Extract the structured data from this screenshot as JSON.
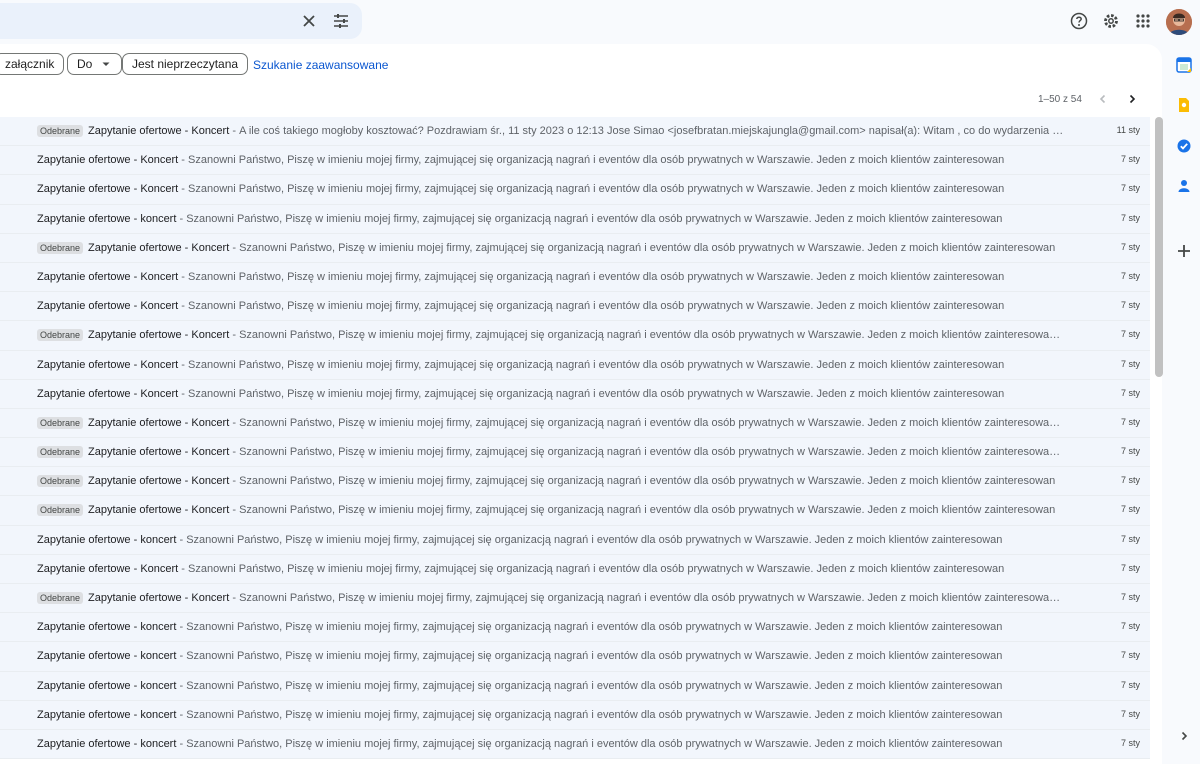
{
  "search": {
    "value": "",
    "placeholder": ""
  },
  "filters": [
    {
      "label": "załącznik"
    },
    {
      "label": "Do"
    },
    {
      "label": "Jest nieprzeczytana"
    }
  ],
  "advanced_search": "Szukanie zaawansowane",
  "pager": {
    "range": "1–50 z 54"
  },
  "emails": [
    {
      "badge": "Odebrane",
      "subject": "Zapytanie ofertowe - Koncert",
      "snippet": "A ile coś takiego mogłoby kosztować? Pozdrawiam śr., 11 sty 2023 o 12:13 Jose Simao <josefbratan.miejskajungla@gmail.com> napisał(a): Witam , co do wydarzenia jest to morzliwe ...",
      "date": "11 sty"
    },
    {
      "badge": "",
      "subject": "Zapytanie ofertowe - Koncert",
      "snippet": "Szanowni Państwo, Piszę w imieniu mojej firmy, zajmującej się organizacją nagrań i eventów dla osób prywatnych w Warszawie. Jeden z moich klientów zainteresowan",
      "date": "7 sty"
    },
    {
      "badge": "",
      "subject": "Zapytanie ofertowe - Koncert",
      "snippet": "Szanowni Państwo, Piszę w imieniu mojej firmy, zajmującej się organizacją nagrań i eventów dla osób prywatnych w Warszawie. Jeden z moich klientów zainteresowan",
      "date": "7 sty"
    },
    {
      "badge": "",
      "subject": "Zapytanie ofertowe - koncert",
      "snippet": "Szanowni Państwo, Piszę w imieniu mojej firmy, zajmującej się organizacją nagrań i eventów dla osób prywatnych w Warszawie. Jeden z moich klientów zainteresowan",
      "date": "7 sty"
    },
    {
      "badge": "Odebrane",
      "subject": "Zapytanie ofertowe - Koncert",
      "snippet": "Szanowni Państwo, Piszę w imieniu mojej firmy, zajmującej się organizacją nagrań i eventów dla osób prywatnych w Warszawie. Jeden z moich klientów zainteresowan",
      "date": "7 sty"
    },
    {
      "badge": "",
      "subject": "Zapytanie ofertowe - Koncert",
      "snippet": "Szanowni Państwo, Piszę w imieniu mojej firmy, zajmującej się organizacją nagrań i eventów dla osób prywatnych w Warszawie. Jeden z moich klientów zainteresowan",
      "date": "7 sty"
    },
    {
      "badge": "",
      "subject": "Zapytanie ofertowe - Koncert",
      "snippet": "Szanowni Państwo, Piszę w imieniu mojej firmy, zajmującej się organizacją nagrań i eventów dla osób prywatnych w Warszawie. Jeden z moich klientów zainteresowan",
      "date": "7 sty"
    },
    {
      "badge": "Odebrane",
      "subject": "Zapytanie ofertowe - Koncert",
      "snippet": "Szanowni Państwo, Piszę w imieniu mojej firmy, zajmującej się organizacją nagrań i eventów dla osób prywatnych w Warszawie. Jeden z moich klientów zainteresowany jest stworze...",
      "date": "7 sty"
    },
    {
      "badge": "",
      "subject": "Zapytanie ofertowe - Koncert",
      "snippet": "Szanowni Państwo, Piszę w imieniu mojej firmy, zajmującej się organizacją nagrań i eventów dla osób prywatnych w Warszawie. Jeden z moich klientów zainteresowan",
      "date": "7 sty"
    },
    {
      "badge": "",
      "subject": "Zapytanie ofertowe - Koncert",
      "snippet": "Szanowni Państwo, Piszę w imieniu mojej firmy, zajmującej się organizacją nagrań i eventów dla osób prywatnych w Warszawie. Jeden z moich klientów zainteresowan",
      "date": "7 sty"
    },
    {
      "badge": "Odebrane",
      "subject": "Zapytanie ofertowe - Koncert",
      "snippet": "Szanowni Państwo, Piszę w imieniu mojej firmy, zajmującej się organizacją nagrań i eventów dla osób prywatnych w Warszawie. Jeden z moich klientów zainteresowany jest stworze...",
      "date": "7 sty"
    },
    {
      "badge": "Odebrane",
      "subject": "Zapytanie ofertowe - Koncert",
      "snippet": "Szanowni Państwo, Piszę w imieniu mojej firmy, zajmującej się organizacją nagrań i eventów dla osób prywatnych w Warszawie. Jeden z moich klientów zainteresowany jest stworze...",
      "date": "7 sty"
    },
    {
      "badge": "Odebrane",
      "subject": "Zapytanie ofertowe - Koncert",
      "snippet": "Szanowni Państwo, Piszę w imieniu mojej firmy, zajmującej się organizacją nagrań i eventów dla osób prywatnych w Warszawie. Jeden z moich klientów zainteresowan",
      "date": "7 sty"
    },
    {
      "badge": "Odebrane",
      "subject": "Zapytanie ofertowe - Koncert",
      "snippet": "Szanowni Państwo, Piszę w imieniu mojej firmy, zajmującej się organizacją nagrań i eventów dla osób prywatnych w Warszawie. Jeden z moich klientów zainteresowan",
      "date": "7 sty"
    },
    {
      "badge": "",
      "subject": "Zapytanie ofertowe - koncert",
      "snippet": "Szanowni Państwo, Piszę w imieniu mojej firmy, zajmującej się organizacją nagrań i eventów dla osób prywatnych w Warszawie. Jeden z moich klientów zainteresowan",
      "date": "7 sty"
    },
    {
      "badge": "",
      "subject": "Zapytanie ofertowe - Koncert",
      "snippet": "Szanowni Państwo, Piszę w imieniu mojej firmy, zajmującej się organizacją nagrań i eventów dla osób prywatnych w Warszawie. Jeden z moich klientów zainteresowan",
      "date": "7 sty"
    },
    {
      "badge": "Odebrane",
      "subject": "Zapytanie ofertowe - Koncert",
      "snippet": "Szanowni Państwo, Piszę w imieniu mojej firmy, zajmującej się organizacją nagrań i eventów dla osób prywatnych w Warszawie. Jeden z moich klientów zainteresowany jest stworze...",
      "date": "7 sty"
    },
    {
      "badge": "",
      "subject": "Zapytanie ofertowe - koncert",
      "snippet": "Szanowni Państwo, Piszę w imieniu mojej firmy, zajmującej się organizacją nagrań i eventów dla osób prywatnych w Warszawie. Jeden z moich klientów zainteresowan",
      "date": "7 sty"
    },
    {
      "badge": "",
      "subject": "Zapytanie ofertowe - koncert",
      "snippet": "Szanowni Państwo, Piszę w imieniu mojej firmy, zajmującej się organizacją nagrań i eventów dla osób prywatnych w Warszawie. Jeden z moich klientów zainteresowan",
      "date": "7 sty"
    },
    {
      "badge": "",
      "subject": "Zapytanie ofertowe - koncert",
      "snippet": "Szanowni Państwo, Piszę w imieniu mojej firmy, zajmującej się organizacją nagrań i eventów dla osób prywatnych w Warszawie. Jeden z moich klientów zainteresowan",
      "date": "7 sty"
    },
    {
      "badge": "",
      "subject": "Zapytanie ofertowe - koncert",
      "snippet": "Szanowni Państwo, Piszę w imieniu mojej firmy, zajmującej się organizacją nagrań i eventów dla osób prywatnych w Warszawie. Jeden z moich klientów zainteresowan",
      "date": "7 sty"
    },
    {
      "badge": "",
      "subject": "Zapytanie ofertowe - koncert",
      "snippet": "Szanowni Państwo, Piszę w imieniu mojej firmy, zajmującej się organizacją nagrań i eventów dla osób prywatnych w Warszawie. Jeden z moich klientów zainteresowan",
      "date": "7 sty"
    }
  ],
  "icons": {
    "clear": "close-icon",
    "options": "tune-icon",
    "help": "help-icon",
    "settings": "gear-icon",
    "apps": "apps-grid-icon",
    "calendar": "calendar-icon",
    "keep": "keep-icon",
    "tasks": "tasks-icon",
    "contacts": "contacts-icon",
    "add": "plus-icon"
  },
  "colors": {
    "accent": "#0b57d0",
    "row_read": "#f2f6fc",
    "badge_bg": "#dddfe2"
  }
}
